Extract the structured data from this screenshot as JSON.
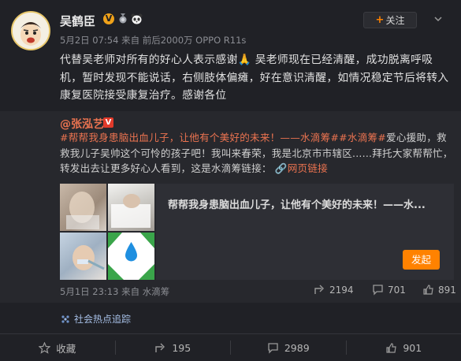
{
  "post": {
    "author": "吴鹤臣",
    "verified_badge": "V",
    "meta": "5月2日 07:54 来自 前后2000万 OPPO R11s",
    "follow_label": "关注",
    "text": "代替吴老师对所有的好心人表示感谢🙏 吴老师现在已经清醒，成功脱离呼吸机，暂时发现不能说话，右侧肢体偏瘫，好在意识清醒，如情况稳定节后将转入康复医院接受康复治疗。感谢各位"
  },
  "repost": {
    "author": "@张泓艺",
    "badge": "V",
    "hashtag1": "#帮帮我身患脑出血儿子，让他有个美好的未来！——水滴筹#",
    "hashtag2": "#水滴筹#",
    "text_main": "爱心援助，救救我儿子吴帅这个可怜的孩子吧！我叫来春荣，我是北京市市辖区......拜托大家帮帮忙，转发出去让更多好心人看到，这是水滴筹链接：",
    "link_label": "网页链接",
    "card_title": "帮帮我身患脑出血儿子，让他有个美好的未来！——水...",
    "donate_label": "发起",
    "meta": "5月1日 23:13 来自 水滴筹",
    "shares": "2194",
    "comments": "701",
    "likes": "891",
    "thumb_logo_text": "水滴筹"
  },
  "topic": {
    "label": "社会热点追踪"
  },
  "actions": {
    "favorite": "收藏",
    "shares": "195",
    "comments": "2989",
    "likes": "901"
  },
  "colors": {
    "accent_orange": "#ff8200",
    "link_orange": "#eb7350",
    "topic_blue": "#a6bfe6"
  }
}
